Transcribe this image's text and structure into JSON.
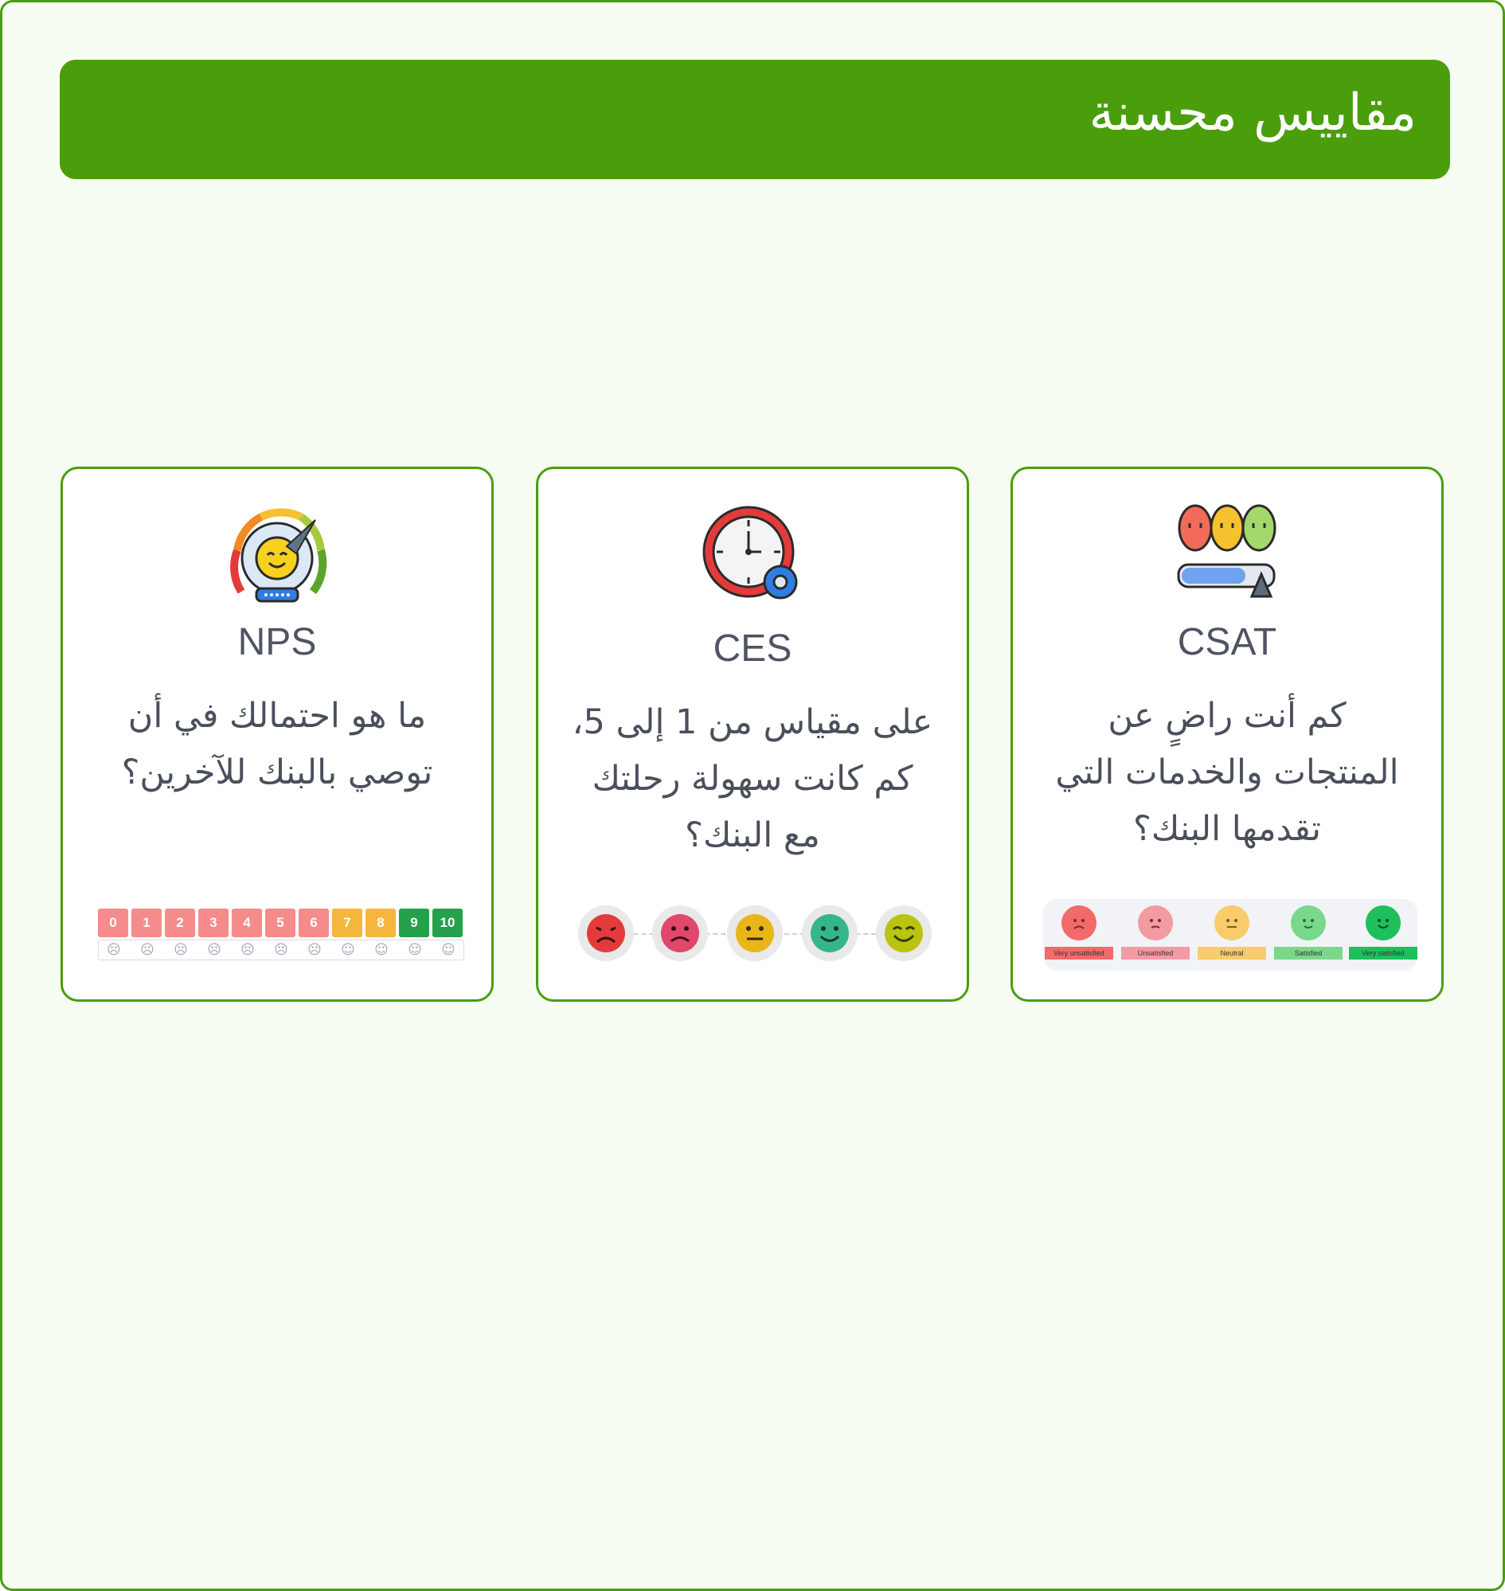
{
  "header": {
    "title": "مقاييس محسنة"
  },
  "cards": {
    "nps": {
      "title": "NPS",
      "question": "ما هو احتمالك في أن توصي بالبنك للآخرين؟",
      "scale": [
        "0",
        "1",
        "2",
        "3",
        "4",
        "5",
        "6",
        "7",
        "8",
        "9",
        "10"
      ],
      "colors": {
        "detractor": "#f58b8b",
        "passive": "#f5b63d",
        "promoter": "#25a04b"
      },
      "icon": "speedometer-smile-icon"
    },
    "ces": {
      "title": "CES",
      "question": "على مقياس من 1 إلى 5، كم كانت سهولة رحلتك مع البنك؟",
      "icon": "clock-gear-icon",
      "face_colors": [
        "#e33b3b",
        "#e0476b",
        "#e8b616",
        "#36b58a",
        "#b8c40f"
      ]
    },
    "csat": {
      "title": "CSAT",
      "question": "كم أنت راضٍ عن المنتجات والخدمات التي تقدمها البنك؟",
      "icon": "satisfaction-slider-icon",
      "labels": [
        "Very unsatisfied",
        "Unsatisfied",
        "Neutral",
        "Satisfied",
        "Very satisfied"
      ],
      "colors": [
        "#f26a6a",
        "#f49aa2",
        "#f9cb6b",
        "#79d98a",
        "#1fbf5c"
      ]
    }
  }
}
